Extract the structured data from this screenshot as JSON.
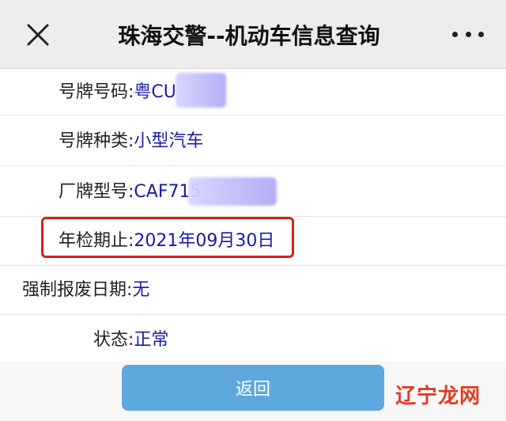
{
  "header": {
    "title": "珠海交警--机动车信息查询"
  },
  "fields": [
    {
      "label": "号牌号码:",
      "value": "粤CU"
    },
    {
      "label": "号牌种类:",
      "value": "小型汽车"
    },
    {
      "label": "厂牌型号:",
      "value": "CAF715"
    },
    {
      "label": "年检期止:",
      "value": "2021年09月30日"
    },
    {
      "label": "强制报废日期:",
      "value": "无"
    },
    {
      "label": "状态:",
      "value": "正常"
    }
  ],
  "return_button": {
    "label": "返回"
  },
  "watermark": {
    "text": "辽宁龙网"
  },
  "colors": {
    "header_bg": "#ededed",
    "value_text": "#1a1aa8",
    "highlight_border": "#dd1c1c",
    "button_bg": "#5fa8de"
  }
}
